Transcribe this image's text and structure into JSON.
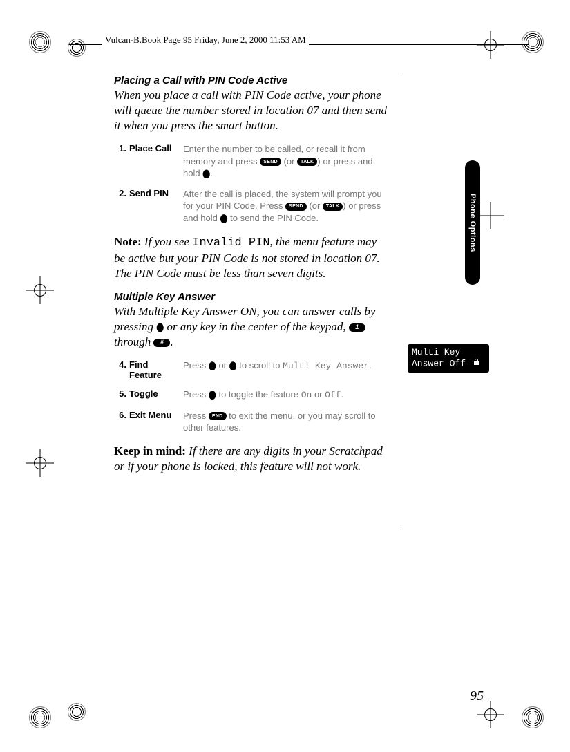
{
  "header": {
    "text": "Vulcan-B.Book  Page 95  Friday, June 2, 2000  11:53 AM"
  },
  "section1": {
    "title": "Placing a Call with PIN Code Active",
    "body": "When you place a call with PIN Code active, your phone will queue the number stored in location 07 and then send it when you press the smart button."
  },
  "steps_a": [
    {
      "num": "1.",
      "label": "Place Call",
      "desc_a": "Enter the number to be called, or recall it from memory and press ",
      "send": "SEND",
      "or1": " (or ",
      "talk": "TALK",
      "or2": ") or press and hold  ",
      "desc_b": "."
    },
    {
      "num": "2.",
      "label": "Send PIN",
      "desc_a": "After the call is placed, the system will prompt you for your PIN Code. Press ",
      "send": "SEND",
      "or1": " (or ",
      "talk": "TALK",
      "or2": ") or press and hold  ",
      "desc_b": " to send the PIN Code."
    }
  ],
  "note": {
    "lead": "Note:",
    "a": " If you see ",
    "code": "Invalid PIN",
    "b": ", the menu feature may be active but your PIN Code is not stored in location 07. The PIN Code must be less than seven digits."
  },
  "section2": {
    "title": "Multiple Key Answer",
    "body_a": "With Multiple Key Answer ON, you can answer calls by pressing ",
    "body_b": " or any key in the center of the keypad, ",
    "key1": "1",
    "body_c": " through ",
    "key2": "#",
    "body_d": "."
  },
  "steps_b": [
    {
      "num": "4.",
      "label": "Find Feature",
      "desc_a": "Press ",
      "mid": " or ",
      "desc_b": " to scroll to ",
      "code": "Multi Key Answer",
      "desc_c": "."
    },
    {
      "num": "5.",
      "label": "Toggle",
      "desc_a": "Press  ",
      "desc_b": " to toggle the feature ",
      "on": "On",
      "or": " or ",
      "off": "Off",
      "desc_c": "."
    },
    {
      "num": "6.",
      "label": "Exit Menu",
      "desc_a": "Press ",
      "end": "END",
      "desc_b": " to exit the menu, or you may scroll to other features."
    }
  ],
  "keep": {
    "lead": "Keep in mind:",
    "text": " If there are any digits in your Scratchpad or if your phone is locked, this feature will not work."
  },
  "sidetab": "Phone Options",
  "screen": {
    "line1": "Multi Key",
    "line2": "Answer Off"
  },
  "page": "95"
}
